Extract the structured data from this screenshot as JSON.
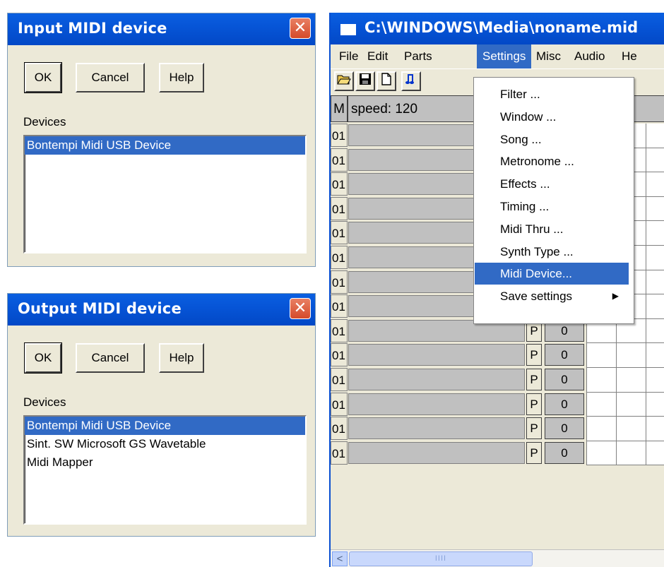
{
  "input_dialog": {
    "title": "Input MIDI device",
    "close": "✕",
    "ok": "OK",
    "cancel": "Cancel",
    "help": "Help",
    "devices_label": "Devices",
    "devices": [
      "Bontempi Midi USB Device"
    ],
    "selected_index": 0
  },
  "output_dialog": {
    "title": "Output MIDI device",
    "close": "✕",
    "ok": "OK",
    "cancel": "Cancel",
    "help": "Help",
    "devices_label": "Devices",
    "devices": [
      "Bontempi Midi USB Device",
      "Sint. SW Microsoft GS Wavetable",
      "Midi Mapper"
    ],
    "selected_index": 0
  },
  "main_window": {
    "title": "C:\\WINDOWS\\Media\\noname.mid",
    "menu": [
      "File",
      "Edit",
      "Parts",
      "Settings",
      "Misc",
      "Audio",
      "He"
    ],
    "active_menu": "Settings",
    "toolbar_icons": [
      "open-folder-icon",
      "save-disk-icon",
      "new-document-icon",
      "notes-icon"
    ],
    "header": {
      "m": "M",
      "speed": "speed: 120"
    },
    "rows": [
      {
        "num": "01",
        "p": "",
        "val": ""
      },
      {
        "num": "01",
        "p": "",
        "val": ""
      },
      {
        "num": "01",
        "p": "",
        "val": ""
      },
      {
        "num": "01",
        "p": "",
        "val": ""
      },
      {
        "num": "01",
        "p": "",
        "val": ""
      },
      {
        "num": "01",
        "p": "",
        "val": ""
      },
      {
        "num": "01",
        "p": "P",
        "val": "0"
      },
      {
        "num": "01",
        "p": "P",
        "val": "0"
      },
      {
        "num": "01",
        "p": "P",
        "val": "0"
      },
      {
        "num": "01",
        "p": "P",
        "val": "0"
      },
      {
        "num": "01",
        "p": "P",
        "val": "0"
      },
      {
        "num": "01",
        "p": "P",
        "val": "0"
      },
      {
        "num": "01",
        "p": "P",
        "val": "0"
      },
      {
        "num": "01",
        "p": "P",
        "val": "0"
      }
    ],
    "scroll_left": "<",
    "scroll_grip": "IIII"
  },
  "settings_menu": {
    "items": [
      "Filter ...",
      "Window ...",
      "Song ...",
      "Metronome ...",
      "Effects ...",
      "Timing ...",
      "Midi Thru ...",
      "Synth Type ...",
      "Midi Device...",
      "Save settings"
    ],
    "highlighted": "Midi Device...",
    "submenu_item": "Save settings",
    "submenu_arrow": "▶"
  },
  "colors": {
    "titlebar": "#0654d6",
    "selection": "#316ac5",
    "face": "#ece9d8"
  }
}
